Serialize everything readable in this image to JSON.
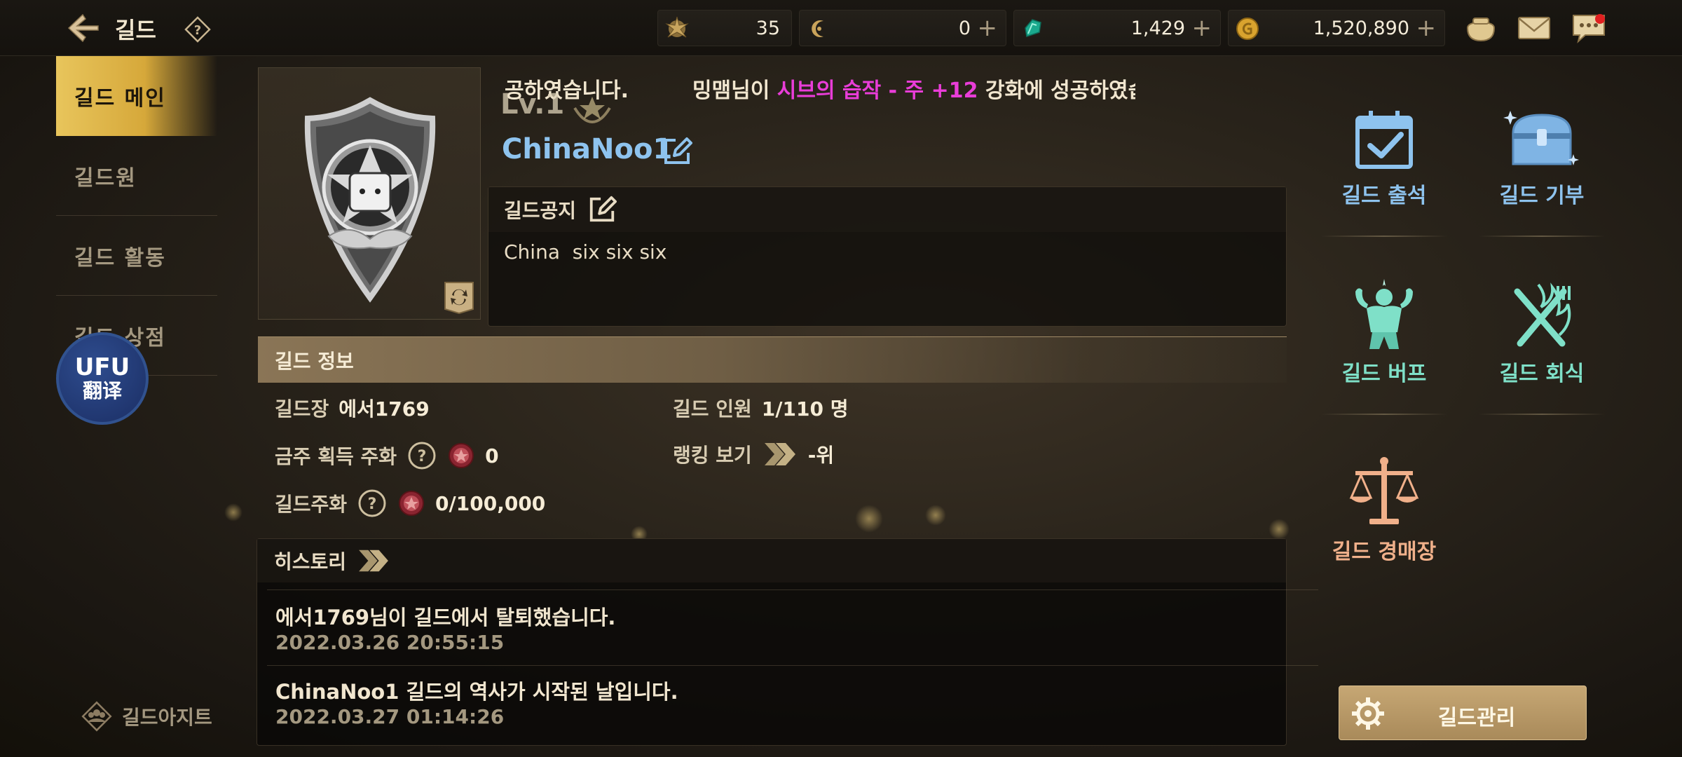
{
  "header": {
    "title": "길드",
    "currencies": [
      {
        "icon": "star-medal-icon",
        "value": "35"
      },
      {
        "icon": "crescent-coin-icon",
        "value": "0"
      },
      {
        "icon": "green-gem-icon",
        "value": "1,429"
      },
      {
        "icon": "gold-coin-icon",
        "value": "1,520,890"
      }
    ]
  },
  "nav": {
    "items": [
      {
        "label": "길드 메인",
        "active": true
      },
      {
        "label": "길드원",
        "active": false
      },
      {
        "label": "길드 활동",
        "active": false
      },
      {
        "label": "길드 상점",
        "active": false
      }
    ],
    "hideout_label": "길드아지트"
  },
  "translate_badge": {
    "logo": "UFU",
    "text": "翻译"
  },
  "ticker": {
    "prefix_cut": "공하였습니다.",
    "user": "밍맴님이 ",
    "item": "시브의 습작 - 주 +12",
    "suffix": " 강화에 성공하였습니다."
  },
  "guild": {
    "level": "Lv.1",
    "name": "ChinaNoo1",
    "notice_title": "길드공지",
    "notice_text": "China  six six six"
  },
  "info": {
    "title": "길드 정보",
    "leader_label": "길드장",
    "leader_value": "에서1769",
    "members_label": "길드 인원",
    "members_value": "1/110 명",
    "weekly_label": "금주 획득 주화",
    "weekly_value": "0",
    "ranking_label": "랭킹 보기",
    "ranking_value": "-위",
    "coins_label": "길드주화",
    "coins_value": "0/100,000"
  },
  "history": {
    "title": "히스토리",
    "items": [
      {
        "msg": "에서1769님이 길드에서 탈퇴했습니다.",
        "time": "2022.03.26 20:55:15"
      },
      {
        "msg": "ChinaNoo1 길드의 역사가 시작된 날입니다.",
        "time": "2022.03.27 01:14:26"
      }
    ]
  },
  "right_menu": {
    "attendance": "길드 출석",
    "donation": "길드 기부",
    "buff": "길드 버프",
    "dinner": "길드 회식",
    "auction": "길드 경매장",
    "manage": "길드관리"
  },
  "colors": {
    "accent_gold": "#d6a83a",
    "name_blue": "#8ec3ee",
    "teal": "#7fe0c8",
    "blue_label": "#8ec3ee",
    "orange_label": "#f0b08a",
    "ticker_pink": "#e93dd8"
  }
}
